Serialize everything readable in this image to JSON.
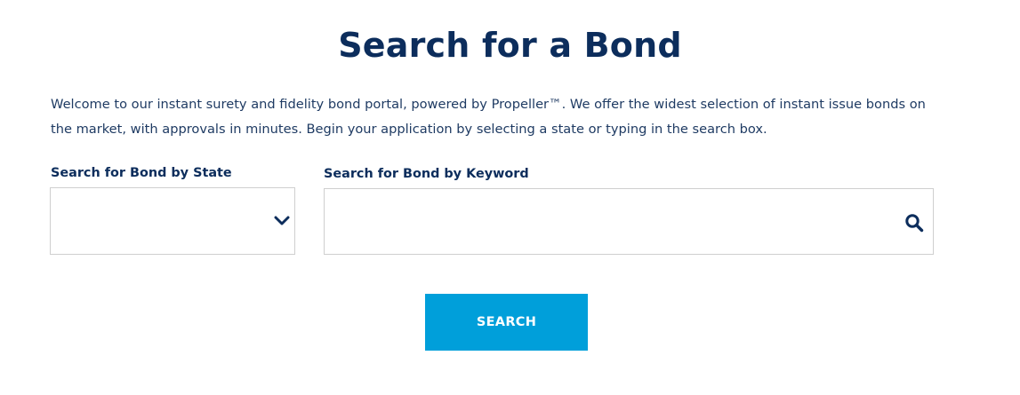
{
  "page": {
    "title": "Search for a Bond",
    "intro": "Welcome to our instant surety and fidelity bond portal, powered by Propeller™. We offer the widest selection of instant issue bonds on the market, with approvals in minutes. Begin your application by selecting a state or typing in the search box."
  },
  "state_filter": {
    "label": "Search for Bond by State",
    "selected_value": "",
    "icon": "chevron-down-icon"
  },
  "keyword_filter": {
    "label": "Search for Bond by Keyword",
    "value": "",
    "placeholder": "",
    "icon": "search-icon"
  },
  "actions": {
    "search_label": "SEARCH"
  },
  "colors": {
    "heading": "#0c2d5c",
    "body_text": "#1f3b63",
    "button_bg": "#009fda",
    "button_text": "#ffffff",
    "border": "#cfcfcf"
  }
}
